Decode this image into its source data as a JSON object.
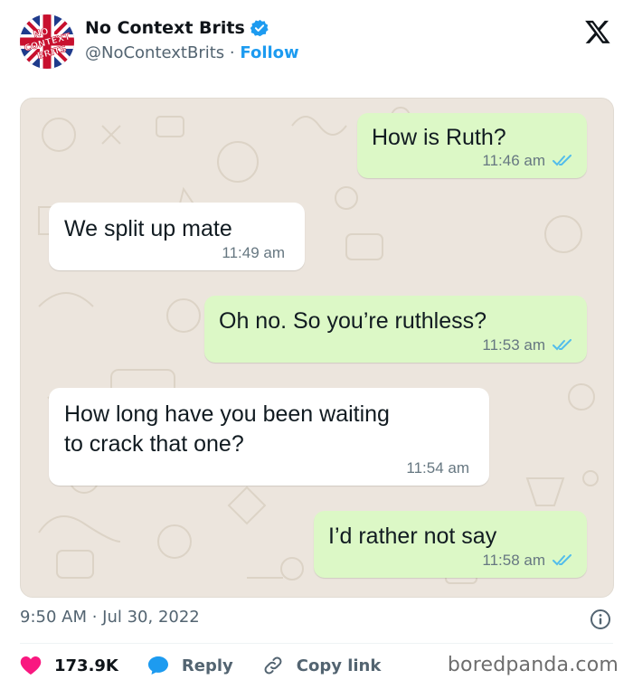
{
  "post": {
    "author_name": "No Context Brits",
    "handle": "@NoContextBrits",
    "separator": "·",
    "follow_label": "Follow",
    "avatar_text_top": "NO",
    "avatar_text_mid": "CONTEXT",
    "avatar_text_bot": "BRITS"
  },
  "chat": {
    "messages": [
      {
        "side": "out",
        "text": "How is Ruth?",
        "time": "11:46 am"
      },
      {
        "side": "in",
        "text": "We split up mate",
        "time": "11:49 am"
      },
      {
        "side": "out",
        "text": "Oh no. So you’re ruthless?",
        "time": "11:53 am"
      },
      {
        "side": "in",
        "text": "How long have you been waiting",
        "text2": "to crack that one?",
        "time": "11:54 am"
      },
      {
        "side": "out",
        "text": "I’d rather not say",
        "time": "11:58 am"
      }
    ]
  },
  "footer": {
    "timestamp": "9:50 AM · Jul 30, 2022",
    "likes": "173.9K",
    "reply_label": "Reply",
    "copy_link_label": "Copy link",
    "watermark": "boredpanda.com"
  },
  "colors": {
    "verified": "#1d9bf0",
    "like": "#f91880",
    "reply": "#1d9bf0",
    "outgoing_bubble": "#dcf8c6",
    "chat_bg": "#ece5dd",
    "read_ticks": "#53bdeb"
  },
  "icons": [
    "verified-badge-icon",
    "x-logo-icon",
    "double-check-icon",
    "info-icon",
    "heart-icon",
    "reply-bubble-icon",
    "link-icon"
  ]
}
